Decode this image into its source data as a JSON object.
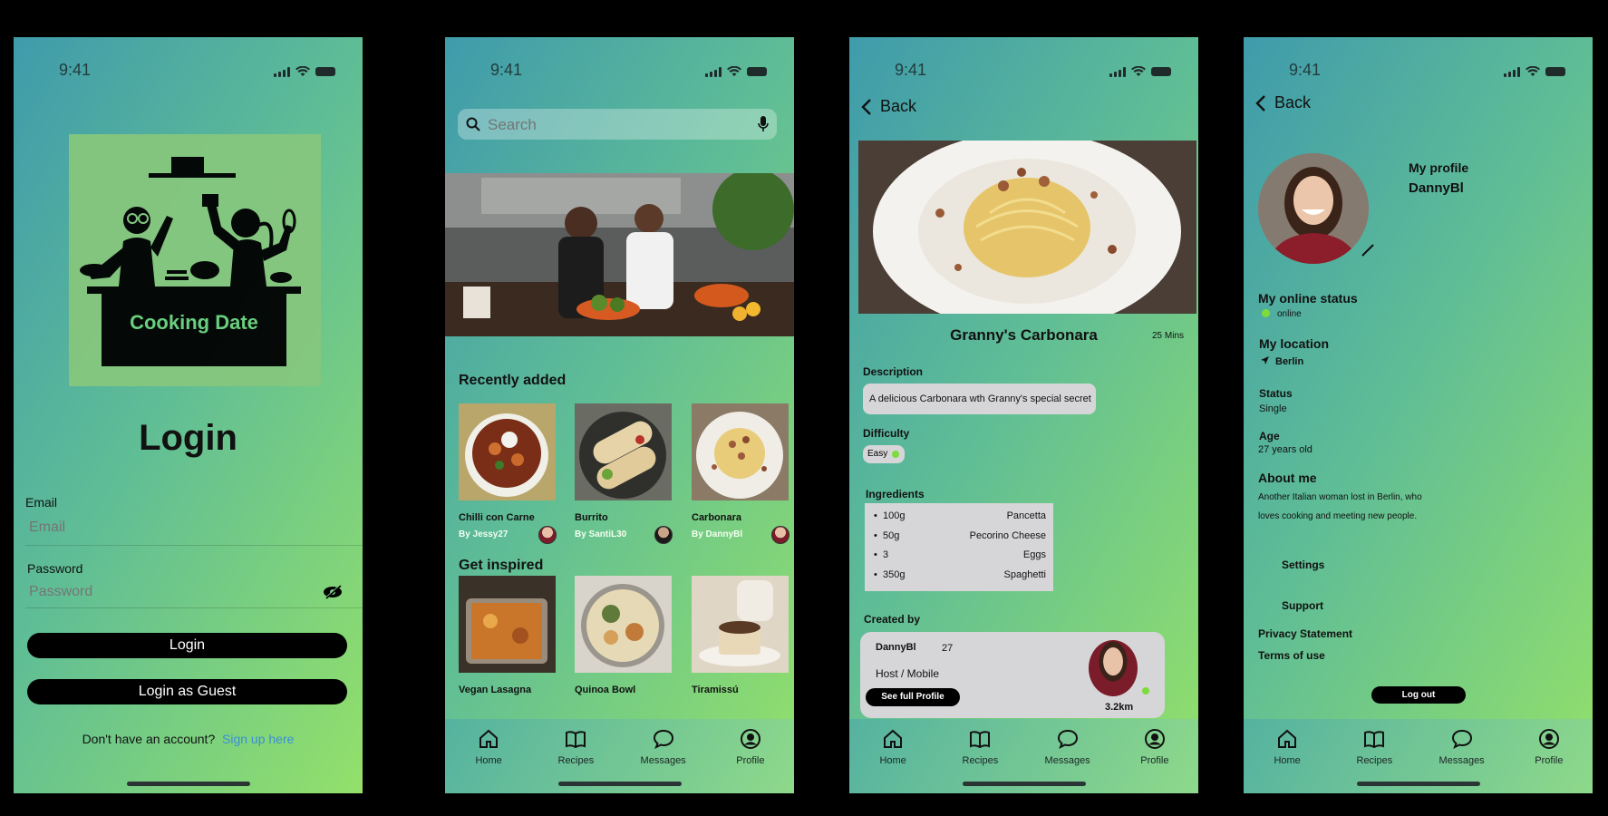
{
  "status": {
    "time": "9:41"
  },
  "login": {
    "logo_text": "Cooking Date",
    "title": "Login",
    "email_label": "Email",
    "email_placeholder": "Email",
    "password_label": "Password",
    "password_placeholder": "Password",
    "login_button": "Login",
    "guest_button": "Login as Guest",
    "signup_prompt": "Don't have an account?",
    "signup_link": "Sign up here"
  },
  "browse": {
    "search_placeholder": "Search",
    "recent_title": "Recently added",
    "recent": [
      {
        "name": "Chilli con Carne",
        "author": "By Jessy27"
      },
      {
        "name": "Burrito",
        "author": "By SantiL30"
      },
      {
        "name": "Carbonara",
        "author": "By DannyBl"
      }
    ],
    "inspired_title": "Get inspired",
    "inspired": [
      {
        "name": "Vegan Lasagna"
      },
      {
        "name": "Quinoa Bowl"
      },
      {
        "name": "Tiramissú"
      }
    ]
  },
  "tabs": [
    "Home",
    "Recipes",
    "Messages",
    "Profile"
  ],
  "recipe": {
    "back": "Back",
    "title": "Granny's Carbonara",
    "time": "25 Mins",
    "description_label": "Description",
    "description": "A delicious Carbonara wth Granny's special secret",
    "difficulty_label": "Difficulty",
    "difficulty": "Easy",
    "ingredients_label": "Ingredients",
    "ingredients": [
      {
        "qty": "100g",
        "item": "Pancetta"
      },
      {
        "qty": "50g",
        "item": "Pecorino Cheese"
      },
      {
        "qty": "3",
        "item": "Eggs"
      },
      {
        "qty": "350g",
        "item": "Spaghetti"
      }
    ],
    "created_by_label": "Created by",
    "creator_name": "DannyBl",
    "creator_age": "27",
    "creator_role": "Host / Mobile",
    "creator_distance": "3.2km",
    "see_profile": "See full Profile"
  },
  "profile": {
    "back": "Back",
    "heading": "My profile",
    "username": "DannyBl",
    "online_label": "My online status",
    "online_value": "online",
    "location_label": "My location",
    "location_value": "Berlin",
    "status_label": "Status",
    "status_value": "Single",
    "age_label": "Age",
    "age_value": "27 years old",
    "about_label": "About me",
    "about_line1": "Another Italian woman lost in Berlin, who",
    "about_line2": "loves cooking and meeting new people.",
    "settings": "Settings",
    "support": "Support",
    "privacy": "Privacy Statement",
    "terms": "Terms of use",
    "logout": "Log out"
  },
  "colors": {
    "online": "#7ddb3b",
    "link": "#3a8fd6"
  }
}
